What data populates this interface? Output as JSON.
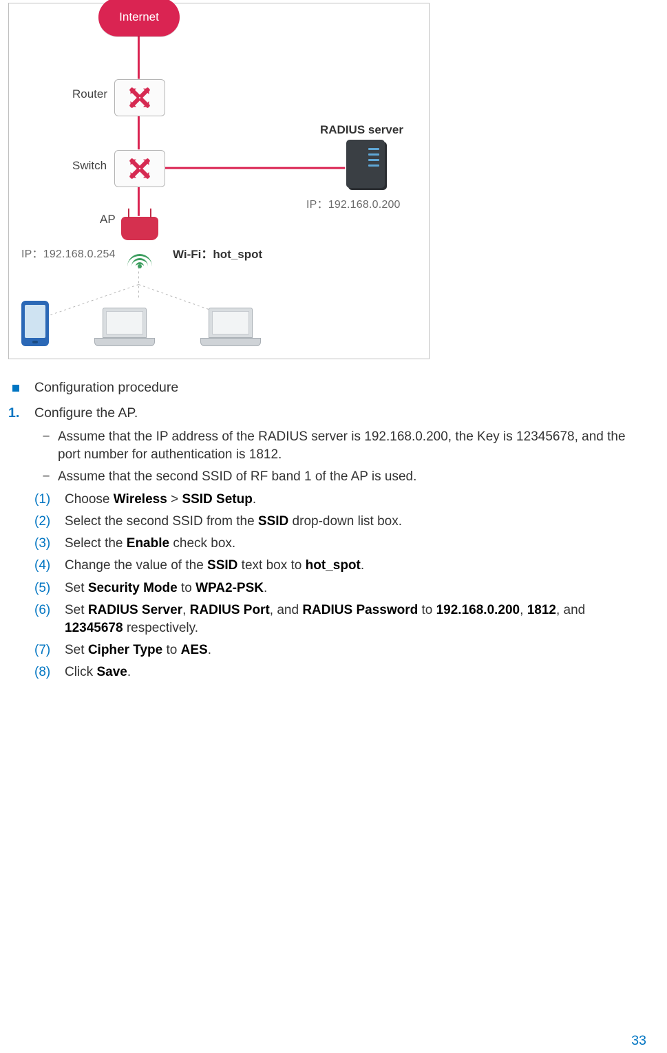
{
  "diagram": {
    "internet": "Internet",
    "router": "Router",
    "switch": "Switch",
    "radius_title": "RADIUS server",
    "radius_ip": "IP：192.168.0.200",
    "ap_label": "AP",
    "ap_ip": "IP：192.168.0.254",
    "wifi_text": "Wi-Fi：hot_spot"
  },
  "section": {
    "title": "Configuration procedure"
  },
  "step1": {
    "num": "1.",
    "title": "Configure the AP.",
    "dash_a": "Assume that the IP address of the RADIUS server is 192.168.0.200, the Key is 12345678, and the port number for authentication is 1812.",
    "dash_b": "Assume that the second SSID of RF band 1 of the AP is used.",
    "s1_n": "(1)",
    "s1_a": "Choose ",
    "s1_b": "Wireless",
    "s1_c": " > ",
    "s1_d": "SSID Setup",
    "s1_e": ".",
    "s2_n": "(2)",
    "s2_a": "Select the second SSID from the ",
    "s2_b": "SSID",
    "s2_c": " drop-down list box.",
    "s3_n": "(3)",
    "s3_a": "Select the ",
    "s3_b": "Enable",
    "s3_c": " check box.",
    "s4_n": "(4)",
    "s4_a": "Change the value of the ",
    "s4_b": "SSID",
    "s4_c": " text box to ",
    "s4_d": "hot_spot",
    "s4_e": ".",
    "s5_n": "(5)",
    "s5_a": "Set ",
    "s5_b": "Security Mode",
    "s5_c": " to ",
    "s5_d": "WPA2-PSK",
    "s5_e": ".",
    "s6_n": "(6)",
    "s6_a": "Set ",
    "s6_b": "RADIUS Server",
    "s6_c": ", ",
    "s6_d": "RADIUS Port",
    "s6_e": ", and ",
    "s6_f": "RADIUS Password",
    "s6_g": " to ",
    "s6_h": "192.168.0.200",
    "s6_i": ", ",
    "s6_j": "1812",
    "s6_k": ", and ",
    "s6_l": "12345678",
    "s6_m": " respectively.",
    "s7_n": "(7)",
    "s7_a": "Set ",
    "s7_b": "Cipher Type",
    "s7_c": " to ",
    "s7_d": "AES",
    "s7_e": ".",
    "s8_n": "(8)",
    "s8_a": "Click ",
    "s8_b": "Save",
    "s8_c": "."
  },
  "page_number": "33"
}
